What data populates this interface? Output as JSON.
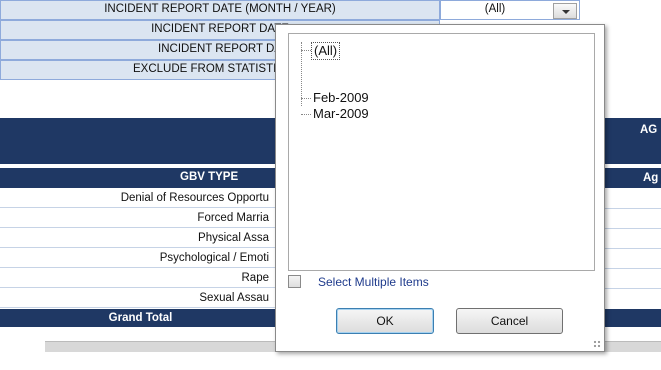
{
  "filters": [
    {
      "label": "INCIDENT REPORT DATE (MONTH / YEAR)",
      "value": "(All)"
    },
    {
      "label": "INCIDENT REPORT DATE"
    },
    {
      "label": "INCIDENT REPORT DA"
    },
    {
      "label": "EXCLUDE FROM STATISTICS/ C"
    }
  ],
  "table": {
    "header_right_1": "AG",
    "header_right_2": "Ag",
    "gbv_type_header": "GBV TYPE",
    "rows": [
      "Denial of Resources Opportu",
      "Forced Marria",
      "Physical Assa",
      "Psychological / Emoti",
      "Rape",
      "Sexual Assau"
    ],
    "grand_total": "Grand Total"
  },
  "popup": {
    "items": [
      "(All)",
      "Feb-2009",
      "Mar-2009"
    ],
    "select_multiple_label": "Select Multiple Items",
    "ok_label": "OK",
    "cancel_label": "Cancel"
  }
}
